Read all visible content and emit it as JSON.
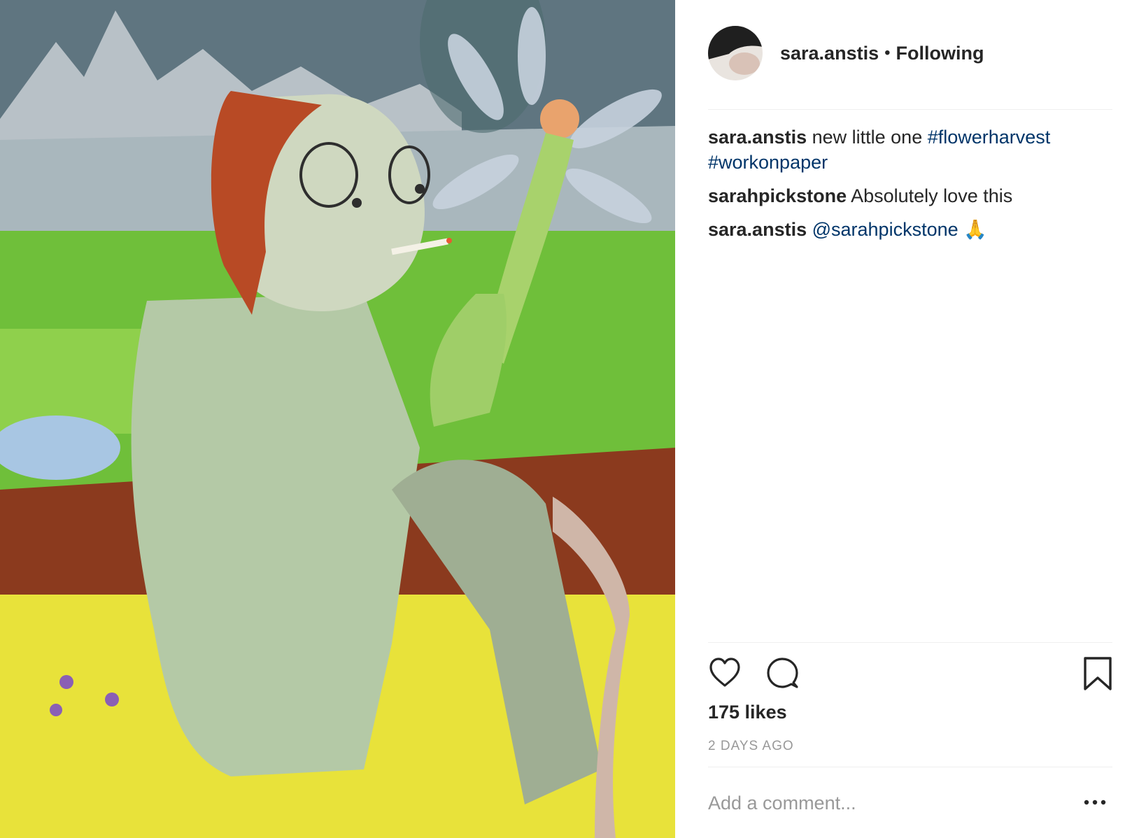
{
  "post": {
    "owner": {
      "username": "sara.anstis",
      "separator": "•",
      "follow_status": "Following"
    },
    "comments": [
      {
        "username": "sara.anstis",
        "parts": [
          {
            "text": "new little one ",
            "tag": false
          },
          {
            "text": "#flowerharvest",
            "tag": true
          },
          {
            "text": " ",
            "tag": false
          },
          {
            "text": "#workonpaper",
            "tag": true
          }
        ]
      },
      {
        "username": "sarahpickstone",
        "parts": [
          {
            "text": "Absolutely love this",
            "tag": false
          }
        ]
      },
      {
        "username": "sara.anstis",
        "parts": [
          {
            "text": "@sarahpickstone",
            "tag": true
          },
          {
            "text": " 🙏",
            "tag": false
          }
        ]
      }
    ],
    "likes": "175 likes",
    "timestamp": "2 DAYS AGO",
    "add_comment_placeholder": "Add a comment...",
    "icons": {
      "like": "heart-icon",
      "comment": "comment-bubble-icon",
      "save": "bookmark-icon",
      "more": "more-options-icon"
    },
    "colors": {
      "hashtag": "#003569",
      "meta": "#999999",
      "divider": "#efefef",
      "text": "#262626"
    }
  }
}
